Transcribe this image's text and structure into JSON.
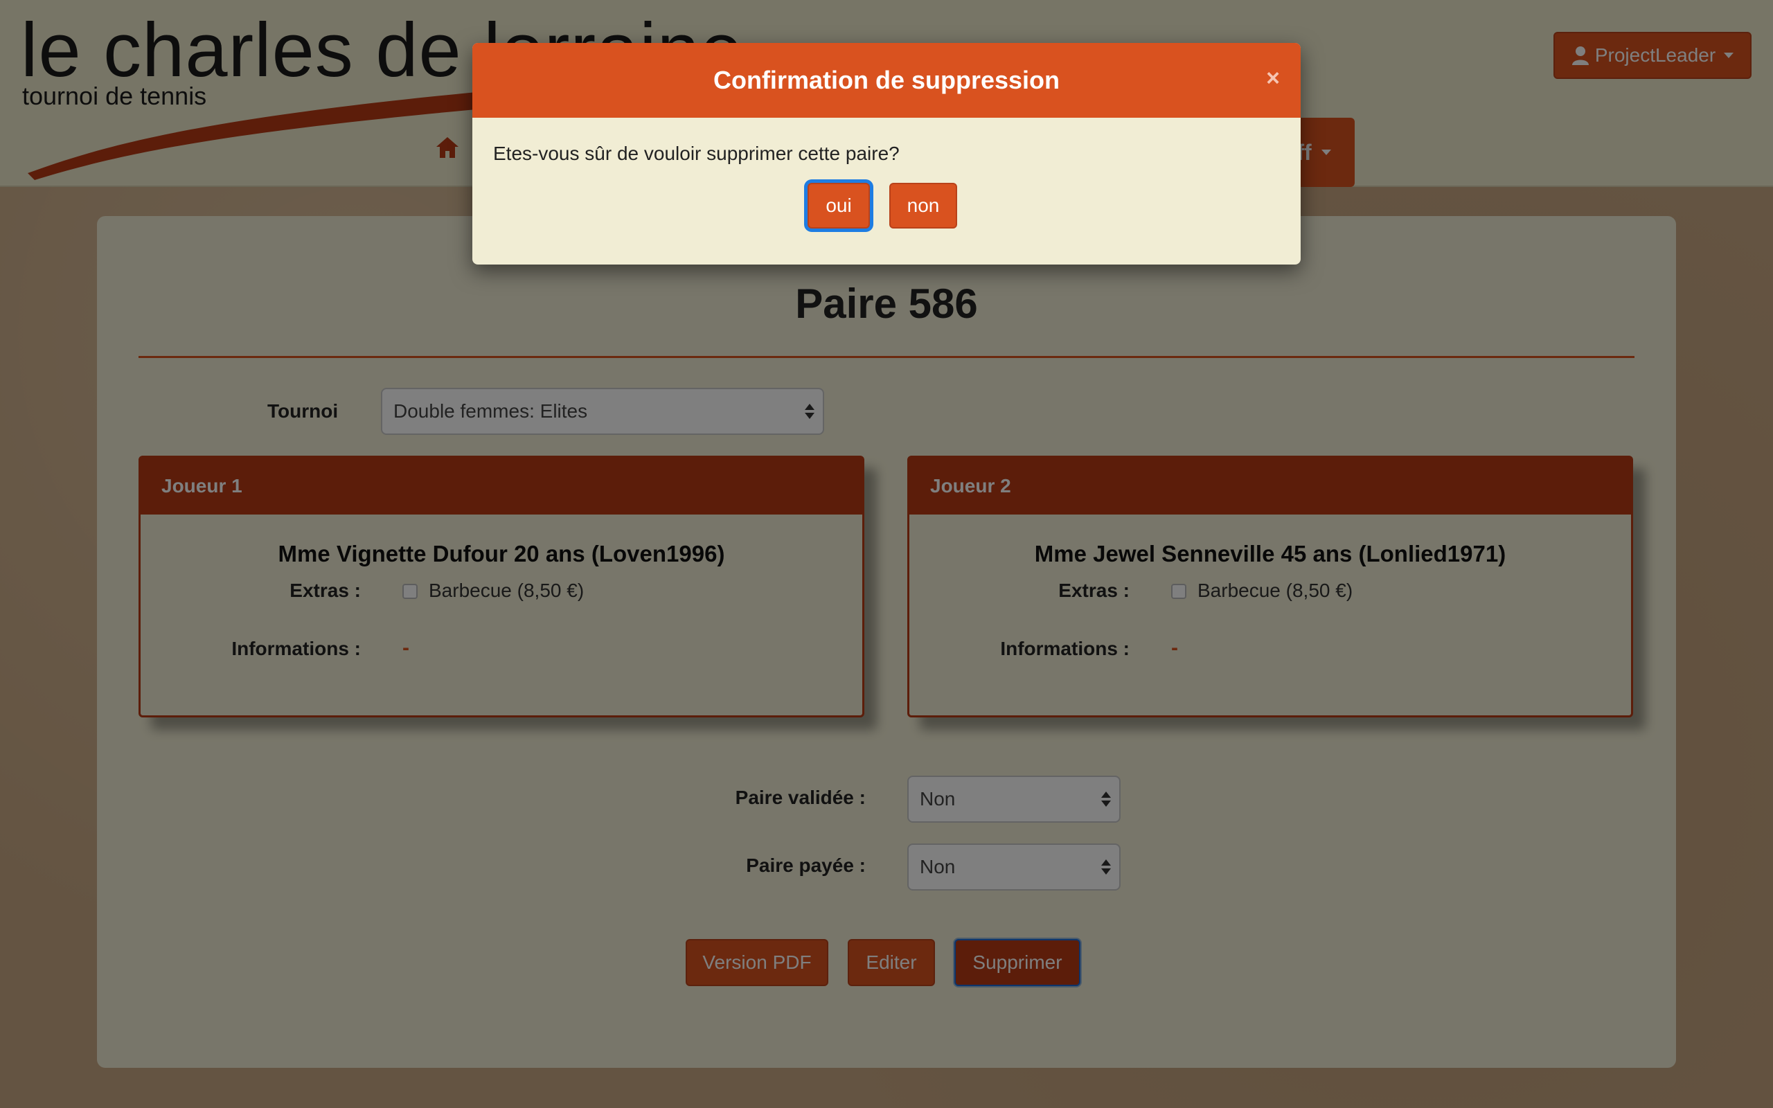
{
  "header": {
    "logo_title": "le charles de lorraine",
    "logo_subtitle": "tournoi de tennis",
    "nav_dropdown_label": "ff",
    "user_menu_label": "ProjectLeader"
  },
  "page": {
    "title": "Paire 586",
    "tournoi_label": "Tournoi",
    "tournoi_value": "Double femmes: Elites"
  },
  "players": [
    {
      "header": "Joueur 1",
      "name": "Mme Vignette Dufour 20 ans (Loven1996)",
      "extras_label": "Extras :",
      "extras_option": "Barbecue (8,50 €)",
      "info_label": "Informations :",
      "info_value": "-"
    },
    {
      "header": "Joueur 2",
      "name": "Mme Jewel Senneville 45 ans (Lonlied1971)",
      "extras_label": "Extras :",
      "extras_option": "Barbecue (8,50 €)",
      "info_label": "Informations :",
      "info_value": "-"
    }
  ],
  "status": {
    "validated_label": "Paire validée :",
    "validated_value": "Non",
    "paid_label": "Paire payée :",
    "paid_value": "Non"
  },
  "actions": {
    "pdf_label": "Version PDF",
    "edit_label": "Editer",
    "delete_label": "Supprimer"
  },
  "modal": {
    "title": "Confirmation de suppression",
    "close_symbol": "×",
    "message": "Etes-vous sûr de vouloir supprimer cette paire?",
    "yes_label": "oui",
    "no_label": "non"
  },
  "colors": {
    "accent": "#d9521f",
    "card_header": "#b83a15",
    "panel": "#f1edd4",
    "focus": "#1e7de3"
  }
}
